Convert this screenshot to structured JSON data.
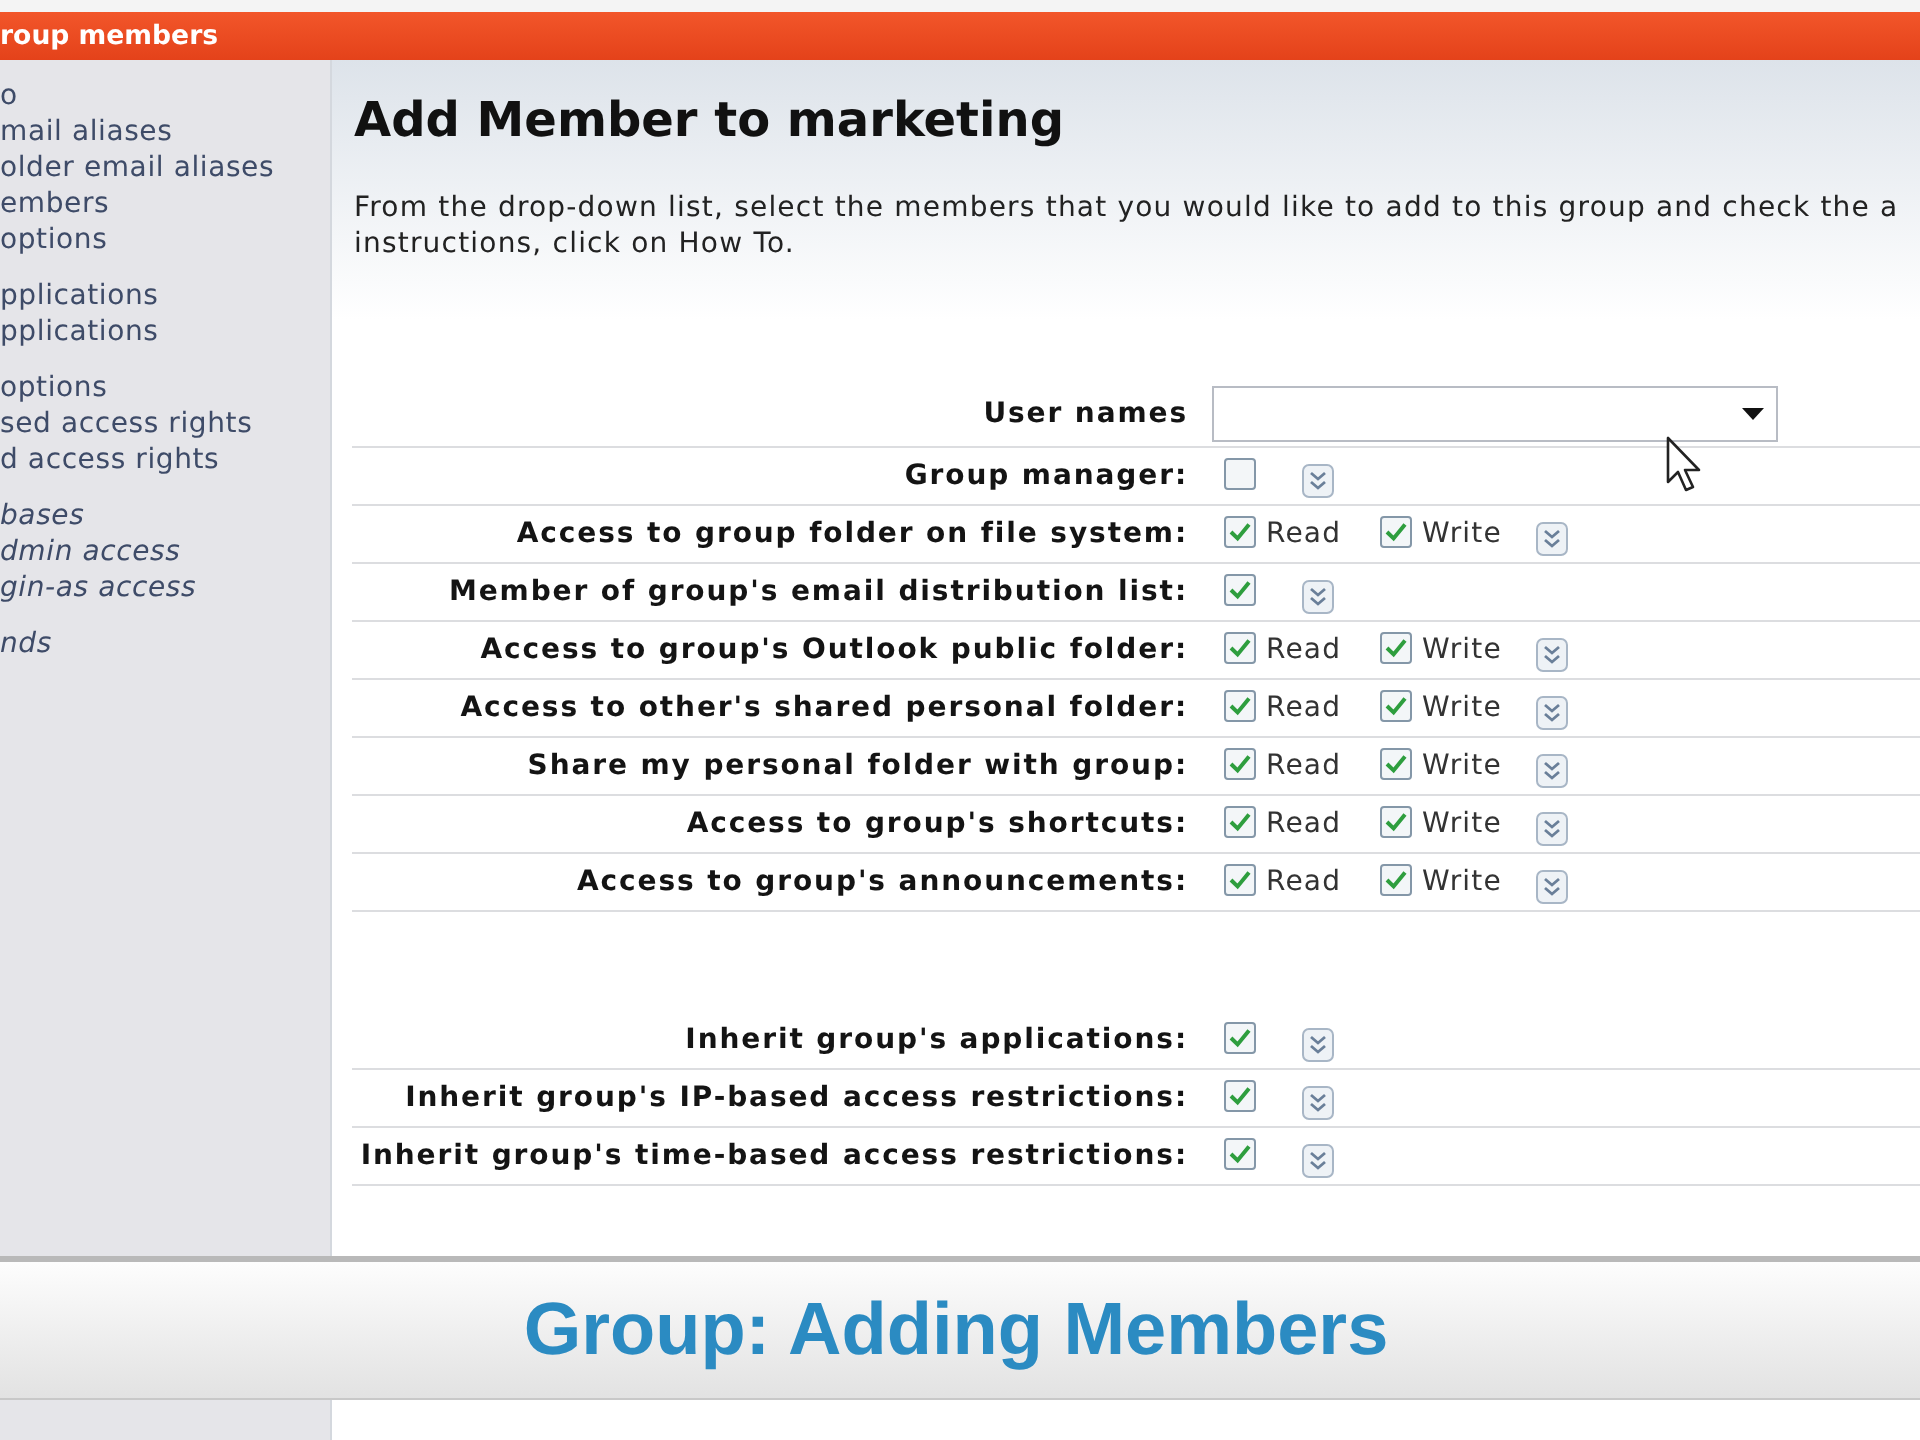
{
  "header": {
    "title": "roup members"
  },
  "sidebar": {
    "groups": [
      {
        "items": [
          {
            "label": "o",
            "disabled": false
          },
          {
            "label": "mail aliases",
            "disabled": false
          },
          {
            "label": "older email aliases",
            "disabled": false
          },
          {
            "label": "embers",
            "disabled": false
          },
          {
            "label": "options",
            "disabled": false
          }
        ]
      },
      {
        "items": [
          {
            "label": "pplications",
            "disabled": false
          },
          {
            "label": "pplications",
            "disabled": false
          }
        ]
      },
      {
        "items": [
          {
            "label": "options",
            "disabled": false
          },
          {
            "label": "sed access rights",
            "disabled": false
          },
          {
            "label": "d access rights",
            "disabled": false
          }
        ]
      },
      {
        "items": [
          {
            "label": "bases",
            "disabled": true
          },
          {
            "label": "dmin access",
            "disabled": true
          },
          {
            "label": "gin-as access",
            "disabled": true
          }
        ]
      },
      {
        "items": [
          {
            "label": "nds",
            "disabled": true
          }
        ]
      }
    ]
  },
  "page": {
    "title": "Add Member to marketing",
    "description_lines": [
      "From the drop-down list, select the members that you would like to add to this group and check the a",
      "instructions, click on How To."
    ]
  },
  "form": {
    "user_names": {
      "label": "User names"
    },
    "sections": [
      {
        "rows": [
          {
            "label": "Group manager:",
            "options": [
              {
                "checked": false
              }
            ]
          },
          {
            "label": "Access to group folder on file system:",
            "options": [
              {
                "label": "Read",
                "checked": true
              },
              {
                "label": "Write",
                "checked": true
              }
            ]
          },
          {
            "label": "Member of group's email distribution list:",
            "options": [
              {
                "checked": true
              }
            ]
          },
          {
            "label": "Access to group's Outlook public folder:",
            "options": [
              {
                "label": "Read",
                "checked": true
              },
              {
                "label": "Write",
                "checked": true
              }
            ]
          },
          {
            "label": "Access to other's shared personal folder:",
            "options": [
              {
                "label": "Read",
                "checked": true
              },
              {
                "label": "Write",
                "checked": true
              }
            ]
          },
          {
            "label": "Share my personal folder with group:",
            "options": [
              {
                "label": "Read",
                "checked": true
              },
              {
                "label": "Write",
                "checked": true
              }
            ]
          },
          {
            "label": "Access to group's shortcuts:",
            "options": [
              {
                "label": "Read",
                "checked": true
              },
              {
                "label": "Write",
                "checked": true
              }
            ]
          },
          {
            "label": "Access to group's announcements:",
            "options": [
              {
                "label": "Read",
                "checked": true
              },
              {
                "label": "Write",
                "checked": true
              }
            ]
          }
        ]
      },
      {
        "rows": [
          {
            "label": "Inherit group's applications:",
            "options": [
              {
                "checked": true
              }
            ]
          },
          {
            "label": "Inherit group's IP-based access restrictions:",
            "options": [
              {
                "checked": true
              }
            ]
          },
          {
            "label": "Inherit group's time-based access restrictions:",
            "options": [
              {
                "checked": true
              }
            ]
          }
        ]
      }
    ]
  },
  "caption": {
    "text": "Group: Adding Members"
  }
}
